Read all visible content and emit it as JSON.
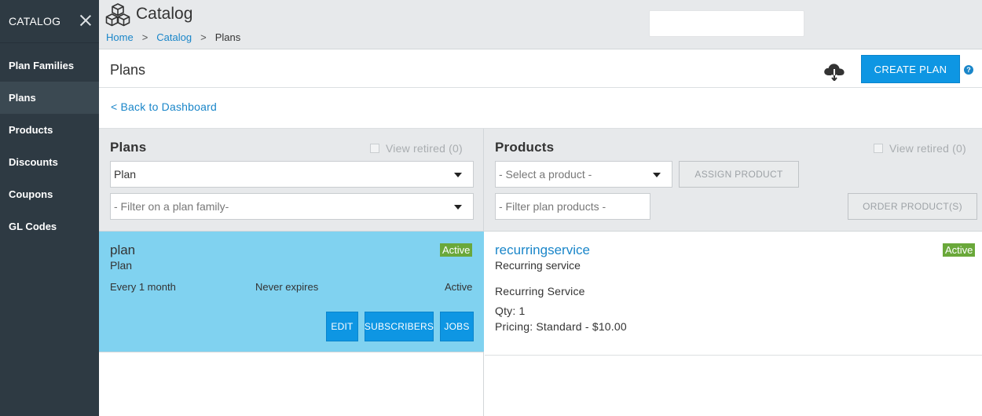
{
  "sidebar": {
    "title": "CATALOG",
    "items": [
      {
        "label": "Plan Families"
      },
      {
        "label": "Plans"
      },
      {
        "label": "Products"
      },
      {
        "label": "Discounts"
      },
      {
        "label": "Coupons"
      },
      {
        "label": "GL Codes"
      }
    ],
    "active_item": "Plans"
  },
  "header": {
    "title": "Catalog",
    "breadcrumb": {
      "home": "Home",
      "separator": ">",
      "catalog": "Catalog",
      "current": "Plans"
    },
    "search_value": ""
  },
  "titlebar": {
    "title": "Plans",
    "create_button": "CREATE PLAN",
    "help": "?"
  },
  "back_link": "< Back to Dashboard",
  "plans_panel": {
    "title": "Plans",
    "view_retired": "View retired (0)",
    "plan_select": "Plan",
    "family_filter": "- Filter on a plan family-"
  },
  "products_panel": {
    "title": "Products",
    "view_retired": "View retired (0)",
    "product_select": "- Select a product -",
    "assign_button": "ASSIGN PRODUCT",
    "filter_placeholder": "- Filter plan products -",
    "order_button": "ORDER PRODUCT(S)"
  },
  "plan_card": {
    "name": "plan",
    "type": "Plan",
    "status_badge": "Active",
    "interval": "Every 1 month",
    "expiry": "Never expires",
    "status": "Active",
    "buttons": {
      "edit": "EDIT",
      "subscribers": "SUBSCRIBERS",
      "jobs": "JOBS"
    }
  },
  "product_card": {
    "name": "recurringservice",
    "type": "Recurring service",
    "status_badge": "Active",
    "description": "Recurring Service",
    "qty": "Qty: 1",
    "pricing": "Pricing: Standard - $10.00"
  },
  "colors": {
    "sidebar": "#2e3a43",
    "accent": "#0e96e3",
    "selected_card": "#80d2f0",
    "active_badge": "#6aa83a",
    "link": "#1a86c9"
  },
  "icons": [
    "close-icon",
    "catalog-cubes-icon",
    "cloud-download-icon",
    "help-icon",
    "chevron-down-icon"
  ]
}
